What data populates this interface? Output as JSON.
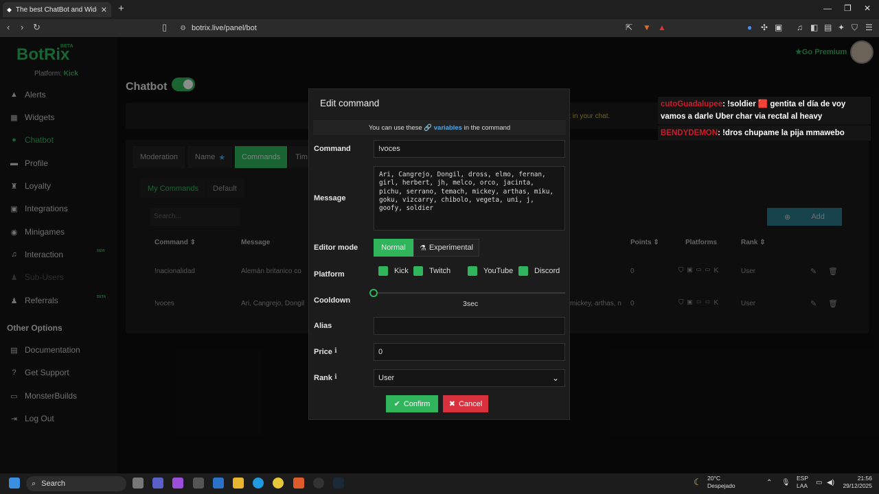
{
  "browser": {
    "tab_title": "The best ChatBot and Widgets fo",
    "url": "botrix.live/panel/bot"
  },
  "sidebar": {
    "logo": "BotRix",
    "beta": "BETA",
    "platform_label": "Platform:",
    "platform_value": "Kick",
    "items": [
      {
        "label": "Alerts"
      },
      {
        "label": "Widgets"
      },
      {
        "label": "Chatbot"
      },
      {
        "label": "Profile"
      },
      {
        "label": "Loyalty"
      },
      {
        "label": "Integrations"
      },
      {
        "label": "Minigames"
      },
      {
        "label": "Interaction",
        "badge": "NEW"
      },
      {
        "label": "Sub-Users"
      },
      {
        "label": "Referrals",
        "badge": "BETA"
      }
    ],
    "other_title": "Other Options",
    "other_items": [
      {
        "label": "Documentation"
      },
      {
        "label": "Get Support"
      },
      {
        "label": "MonsterBuilds"
      },
      {
        "label": "Log Out"
      }
    ]
  },
  "header": {
    "title": "Chatbot",
    "go_premium": "Go Premium",
    "info_text": "x  in your chat."
  },
  "tabs": [
    "Moderation",
    "Name",
    "Commands",
    "Tim"
  ],
  "subtabs": [
    "My Commands",
    "Default"
  ],
  "search_placeholder": "Search...",
  "add_label": "Add",
  "table": {
    "headers": [
      "Command",
      "Message",
      "Points",
      "Platforms",
      "Rank"
    ],
    "rows": [
      {
        "command": "!nacionalidad",
        "message": "Alemán britanico co",
        "message_tail": "",
        "points": "0",
        "rank": "User"
      },
      {
        "command": "!voces",
        "message": "Ari, Cangrejo, Dongil",
        "message_tail": "mickey, arthas, n",
        "points": "0",
        "rank": "User"
      }
    ]
  },
  "chat": [
    {
      "user": "cutoGuadalupee",
      "text": ": !soldier 🟥 gentita el día de voy vamos a darle Uber char via rectal al heavy"
    },
    {
      "user": "BENDYDEMON",
      "text": ": !dros chupame la pija mmawebo"
    }
  ],
  "modal": {
    "title": "Edit command",
    "note_prefix": "You can use these",
    "note_link": "variables",
    "note_suffix": "in the command",
    "command_label": "Command",
    "command_value": "!voces",
    "message_label": "Message",
    "message_value": "Ari, Cangrejo, Dongil, dross, elmo, fernan, girl, herbert, jh, melco, orco, jacinta, pichu, serrano, temach, mickey, arthas, miku, goku, vizcarry, chibolo, vegeta, uni, j, goofy, soldier",
    "editor_mode_label": "Editor mode",
    "editor_normal": "Normal",
    "editor_experimental": "Experimental",
    "platform_label": "Platform",
    "platforms": [
      "Kick",
      "Twitch",
      "YouTube",
      "Discord"
    ],
    "cooldown_label": "Cooldown",
    "cooldown_value": "3sec",
    "alias_label": "Alias",
    "alias_value": "",
    "price_label": "Price",
    "price_value": "0",
    "rank_label": "Rank",
    "rank_value": "User",
    "confirm": "Confirm",
    "cancel": "Cancel"
  },
  "taskbar": {
    "search": "Search",
    "weather_temp": "20°C",
    "weather_desc": "Despejado",
    "lang1": "ESP",
    "lang2": "LAA",
    "time": "21:56",
    "date": "29/12/2025"
  },
  "colors": {
    "accent": "#30b55c",
    "danger": "#d9303e",
    "link": "#4aa8e8"
  }
}
